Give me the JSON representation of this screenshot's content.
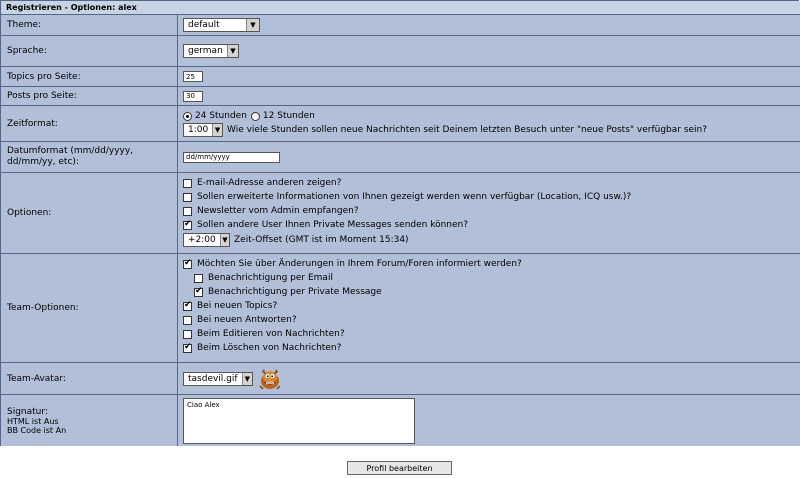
{
  "header": {
    "title": "Registrieren - Optionen: alex"
  },
  "labels": {
    "theme": "Theme:",
    "language": "Sprache:",
    "topics": "Topics pro Seite:",
    "posts": "Posts pro Seite:",
    "timeformat": "Zeitformat:",
    "dateformat": "Datumformat (mm/dd/yyyy, dd/mm/yy, etc):",
    "options": "Optionen:",
    "team_options": "Team-Optionen:",
    "team_avatar": "Team-Avatar:",
    "signature": "Signatur:",
    "signature_html": "HTML ist Aus",
    "signature_bb": "BB Code ist An"
  },
  "theme": {
    "value": "default"
  },
  "language": {
    "value": "german"
  },
  "topics_per_page": "25",
  "posts_per_page": "30",
  "timeformat": {
    "radio_24": "24 Stunden",
    "radio_12": "12 Stunden",
    "hours_select": "1:00",
    "hours_text": "Wie viele Stunden sollen neue Nachrichten seit Deinem letzten Besuch unter \"neue Posts\" verfügbar sein?"
  },
  "dateformat_value": "dd/mm/yyyy",
  "options": {
    "email": "E-mail-Adresse anderen zeigen?",
    "extended": "Sollen erweiterte Informationen von Ihnen gezeigt werden wenn verfügbar (Location, ICQ usw.)?",
    "newsletter": "Newsletter vom Admin empfangen?",
    "pm": "Sollen andere User Ihnen Private Messages senden können?",
    "offset_select": "+2:00",
    "offset_text": "Zeit-Offset (GMT ist im Moment 15:34)"
  },
  "team": {
    "notify": "Möchten Sie über Änderungen in Ihrem Forum/Foren informiert werden?",
    "notify_email": "Benachrichtigung per Email",
    "notify_pm": "Benachrichtigung per Private Message",
    "new_topics": "Bei neuen Topics?",
    "new_replies": "Bei neuen Antworten?",
    "edit": "Beim Editieren von Nachrichten?",
    "delete": "Beim Löschen von Nachrichten?"
  },
  "avatar": {
    "value": "tasdevil.gif"
  },
  "signature_value": "Ciao Alex",
  "submit_label": "Profil bearbeiten"
}
